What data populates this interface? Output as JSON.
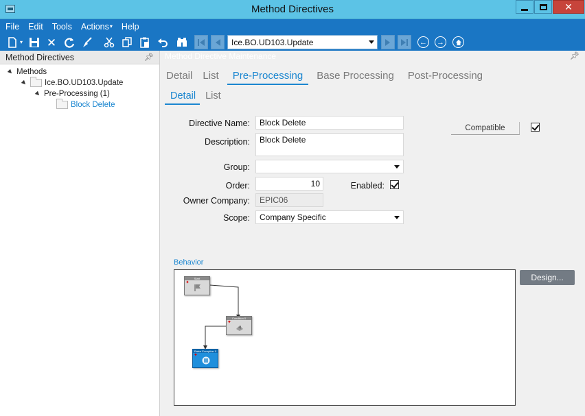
{
  "window": {
    "title": "Method Directives"
  },
  "menu": [
    "File",
    "Edit",
    "Tools",
    "Actions",
    "Help"
  ],
  "toolbar": {
    "method_combo_value": "Ice.BO.UD103.Update"
  },
  "left_panel": {
    "title": "Method Directives",
    "tree": [
      {
        "label": "Methods",
        "level": 0
      },
      {
        "label": "Ice.BO.UD103.Update",
        "level": 1
      },
      {
        "label": "Pre-Processing (1)",
        "level": 2
      },
      {
        "label": "Block Delete",
        "level": 3,
        "selected": true
      }
    ]
  },
  "main": {
    "header": "Method Directive Maintenance",
    "tabs": [
      "Detail",
      "List",
      "Pre-Processing",
      "Base Processing",
      "Post-Processing"
    ],
    "active_tab": "Pre-Processing",
    "subtabs": [
      "Detail",
      "List"
    ],
    "active_subtab": "Detail",
    "form": {
      "directive_name_label": "Directive Name:",
      "directive_name": "Block Delete",
      "description_label": "Description:",
      "description": "Block Delete",
      "group_label": "Group:",
      "group": "",
      "order_label": "Order:",
      "order": "10",
      "enabled_label": "Enabled:",
      "enabled": true,
      "owner_company_label": "Owner Company:",
      "owner_company": "EPIC06",
      "scope_label": "Scope:",
      "scope": "Company Specific",
      "compatible_label": "Compatible",
      "compatible": true
    },
    "behavior": {
      "label": "Behavior",
      "design_button": "Design...",
      "nodes": [
        {
          "label": "Start"
        },
        {
          "label": "Condition 0"
        },
        {
          "label": "Raise Exception 0"
        }
      ]
    }
  },
  "colors": {
    "titlebar": "#5cc3e6",
    "toolbar": "#1a76c4",
    "accent": "#1a86d0",
    "close": "#c7443b"
  }
}
